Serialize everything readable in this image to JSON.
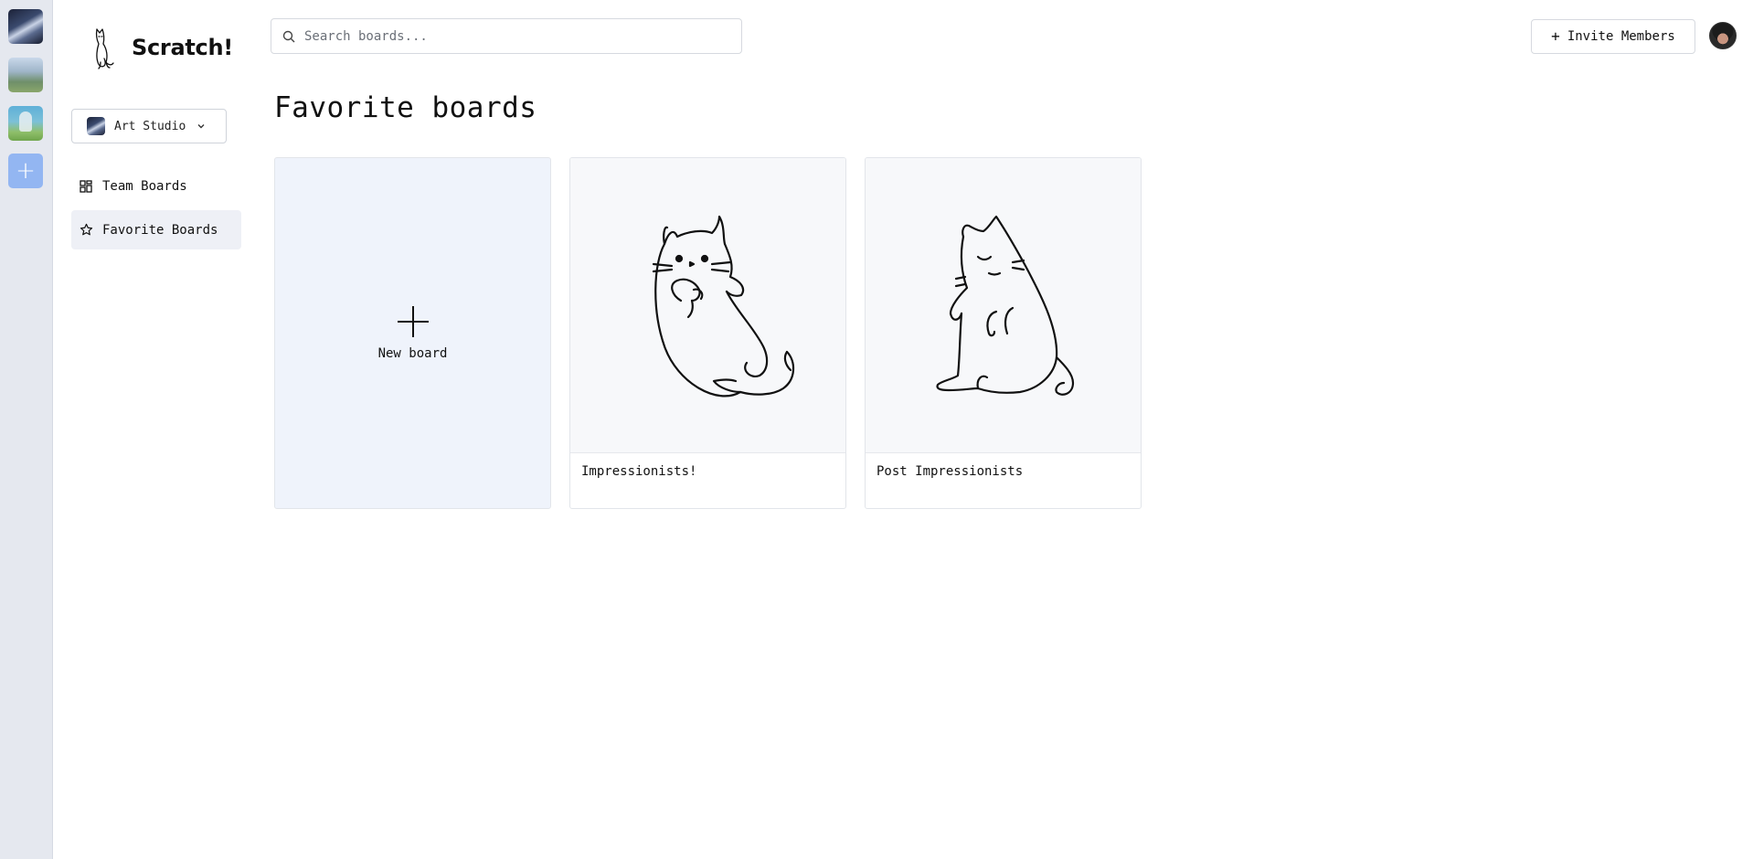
{
  "app": {
    "name": "Scratch!"
  },
  "rail": {
    "orgs": [
      {
        "name": "Art Studio",
        "icon": "org-avatar-night-sky"
      },
      {
        "name": "",
        "icon": "org-avatar-city-park"
      },
      {
        "name": "",
        "icon": "org-avatar-person-field"
      }
    ],
    "add_icon": "plus-icon"
  },
  "sidebar": {
    "org_selector": {
      "label": "Art Studio",
      "icon": "chevron-down-icon"
    },
    "items": [
      {
        "label": "Team Boards",
        "icon": "grid-icon",
        "active": false
      },
      {
        "label": "Favorite Boards",
        "icon": "star-icon",
        "active": true
      }
    ]
  },
  "header": {
    "search_placeholder": "Search boards...",
    "invite_label": "Invite Members"
  },
  "main": {
    "title": "Favorite boards",
    "new_board_label": "New board",
    "boards": [
      {
        "title": "Impressionists!",
        "thumbnail": "cat-rolling-illustration"
      },
      {
        "title": "Post Impressionists",
        "thumbnail": "cat-sitting-illustration"
      }
    ]
  },
  "colors": {
    "rail_bg": "#e5e8ef",
    "rail_add": "#93b6f2",
    "active_nav_bg": "#eef0f6",
    "new_board_bg": "#eff3fb",
    "thumb_bg": "#f7f8fa"
  }
}
